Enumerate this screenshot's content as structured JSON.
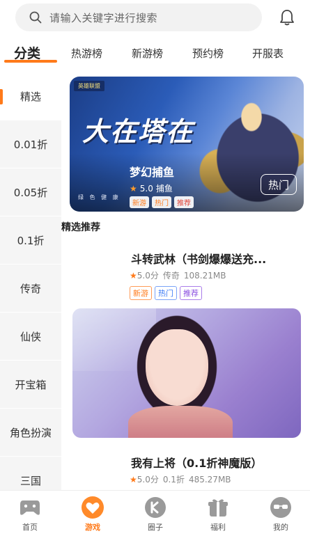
{
  "search": {
    "placeholder": "请输入关键字进行搜索"
  },
  "top_tabs": [
    "分类",
    "热游榜",
    "新游榜",
    "预约榜",
    "开服表"
  ],
  "sidebar": {
    "items": [
      "精选",
      "0.01折",
      "0.05折",
      "0.1折",
      "传奇",
      "仙侠",
      "开宝箱",
      "角色扮演",
      "三国"
    ]
  },
  "banner": {
    "logo_text": "英雄联盟",
    "art_title": "大在塔在",
    "game_name": "梦幻捕鱼",
    "rating": "5.0",
    "genre": "捕鱼",
    "badges": [
      "新游",
      "热门",
      "推荐"
    ],
    "hot_button": "热门",
    "disclaimer": "绿 色 健 康"
  },
  "section": {
    "title": "精选推荐"
  },
  "games": [
    {
      "title": "斗转武林（书剑爆爆送充...",
      "rating": "5.0分",
      "genre": "传奇",
      "size": "108.21MB",
      "tags": [
        "新游",
        "热门",
        "推荐"
      ]
    },
    {
      "title": "我有上将（0.1折神魔版）",
      "rating": "5.0分",
      "genre": "0.1折",
      "size": "485.27MB"
    }
  ],
  "bottom_nav": {
    "items": [
      "首页",
      "游戏",
      "圈子",
      "福利",
      "我的"
    ]
  },
  "colors": {
    "accent": "#ff7a1a",
    "hot": "#3d7cf5",
    "recommend": "#8a4ee0"
  }
}
